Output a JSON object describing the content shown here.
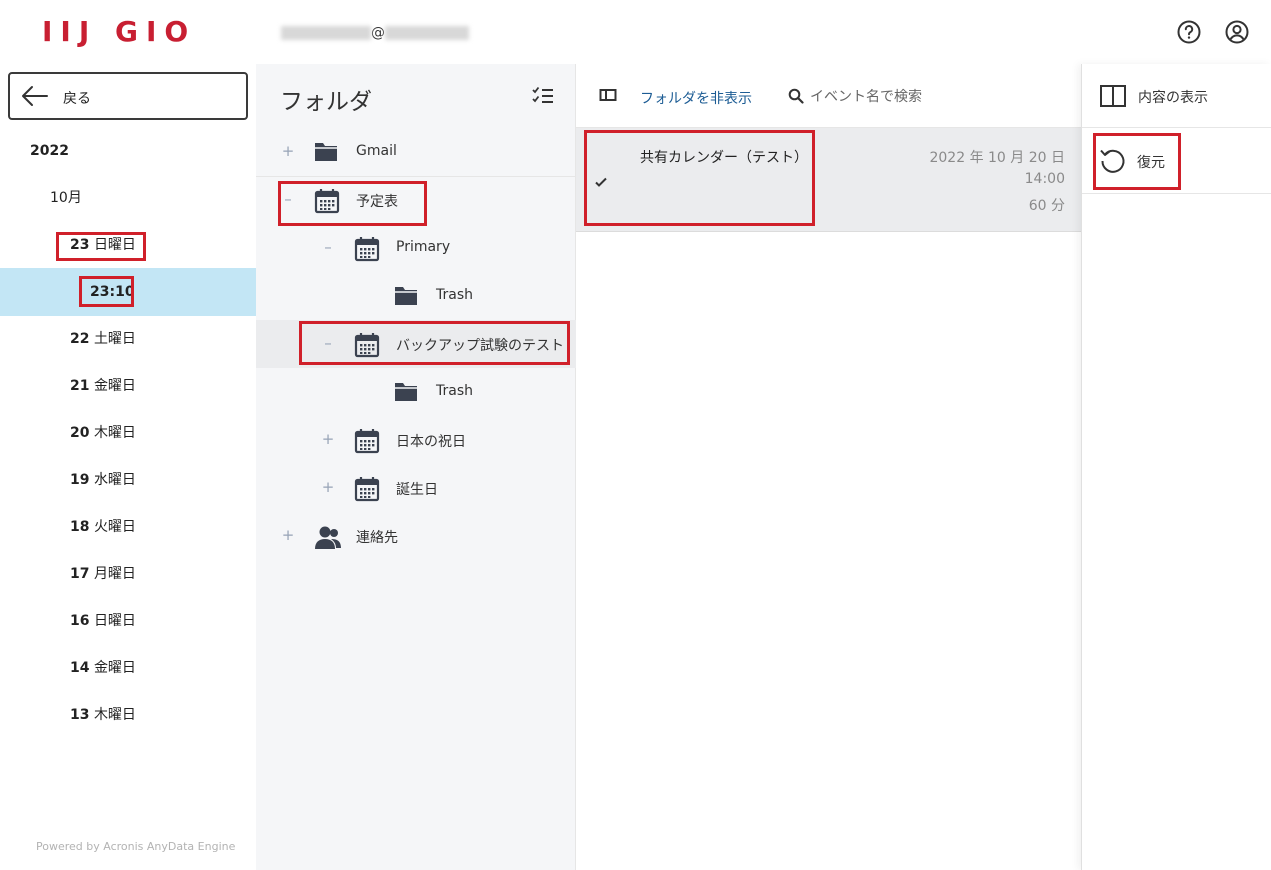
{
  "header": {
    "logo": "IIJ GIO",
    "account_at": "@",
    "help_icon": "help-circle-icon",
    "user_icon": "user-circle-icon"
  },
  "sidebar": {
    "back_label": "戻る",
    "year": "2022",
    "month": "10月",
    "selected_day": {
      "num": "23",
      "weekday": "日曜日"
    },
    "selected_time": "23:10",
    "days": [
      {
        "num": "22",
        "weekday": "土曜日"
      },
      {
        "num": "21",
        "weekday": "金曜日"
      },
      {
        "num": "20",
        "weekday": "木曜日"
      },
      {
        "num": "19",
        "weekday": "水曜日"
      },
      {
        "num": "18",
        "weekday": "火曜日"
      },
      {
        "num": "17",
        "weekday": "月曜日"
      },
      {
        "num": "16",
        "weekday": "日曜日"
      },
      {
        "num": "14",
        "weekday": "金曜日"
      },
      {
        "num": "13",
        "weekday": "木曜日"
      }
    ],
    "powered_by": "Powered by Acronis AnyData Engine"
  },
  "folders": {
    "title": "フォルダ",
    "items": [
      {
        "toggle": "+",
        "icon": "folder-icon",
        "label": "Gmail"
      },
      {
        "toggle": "–",
        "icon": "calendar-icon",
        "label": "予定表"
      },
      {
        "toggle": "–",
        "icon": "calendar-icon",
        "label": "Primary"
      },
      {
        "toggle": "",
        "icon": "folder-icon",
        "label": "Trash"
      },
      {
        "toggle": "–",
        "icon": "calendar-icon",
        "label": "バックアップ試験のテスト"
      },
      {
        "toggle": "",
        "icon": "folder-icon",
        "label": "Trash"
      },
      {
        "toggle": "+",
        "icon": "calendar-icon",
        "label": "日本の祝日"
      },
      {
        "toggle": "+",
        "icon": "calendar-icon",
        "label": "誕生日"
      },
      {
        "toggle": "+",
        "icon": "contacts-icon",
        "label": "連絡先"
      }
    ]
  },
  "events": {
    "hide_folders_label": "フォルダを非表示",
    "search_placeholder": "イベント名で検索",
    "rows": [
      {
        "title": "共有カレンダー（テスト）",
        "date": "2022 年 10 月 20 日",
        "time": "14:00",
        "duration": "60 分",
        "checked": true
      }
    ]
  },
  "panel": {
    "view_label": "内容の表示",
    "restore_label": "復元"
  },
  "colors": {
    "brand_red": "#c81f32",
    "highlight_red": "#d0202a",
    "selected_blue": "#c3e6f5",
    "link_blue": "#1c5c94"
  }
}
